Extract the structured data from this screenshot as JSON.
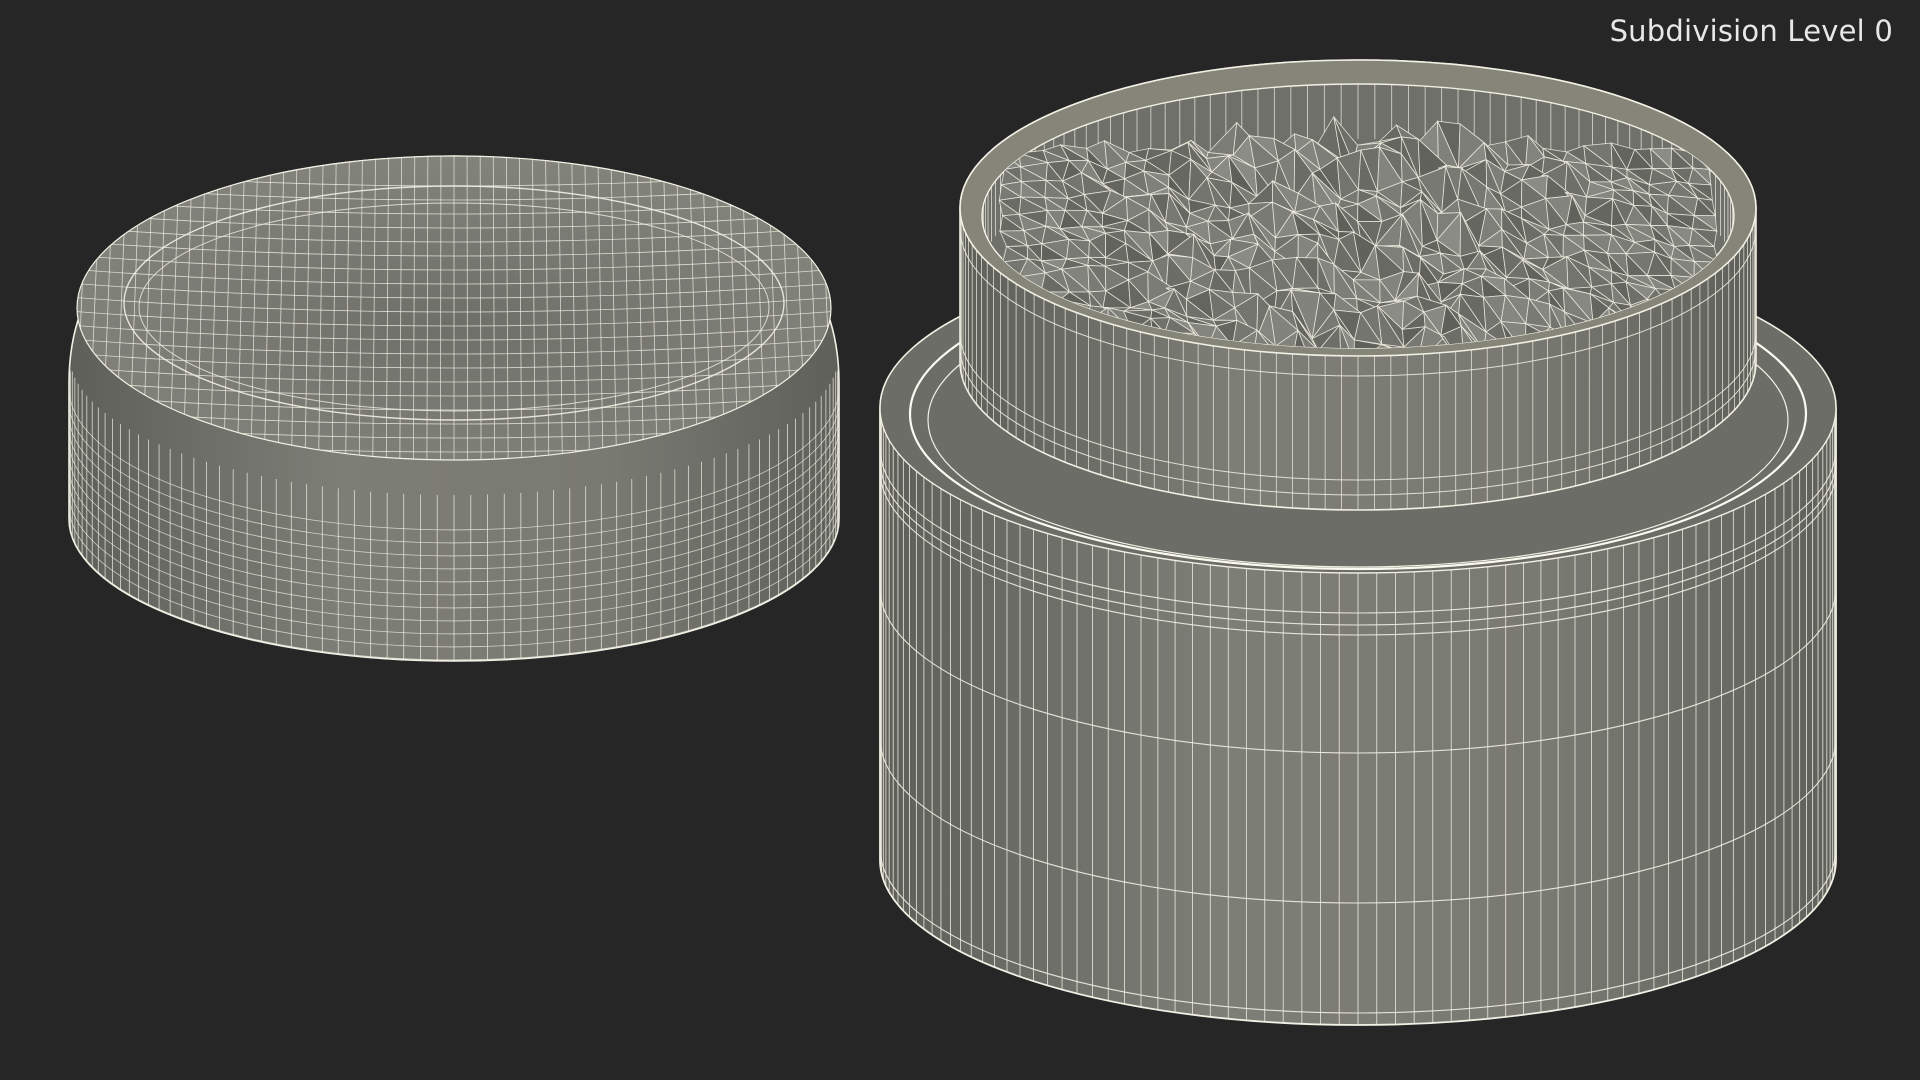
{
  "viewport": {
    "label": "Subdivision Level 0",
    "background_color": "#262626",
    "mesh_fill_color": "#777870",
    "wire_color": "#f2f0e4"
  },
  "scene": {
    "objects": [
      {
        "name": "jar-lid"
      },
      {
        "name": "jar-body"
      },
      {
        "name": "jar-contents"
      }
    ]
  }
}
